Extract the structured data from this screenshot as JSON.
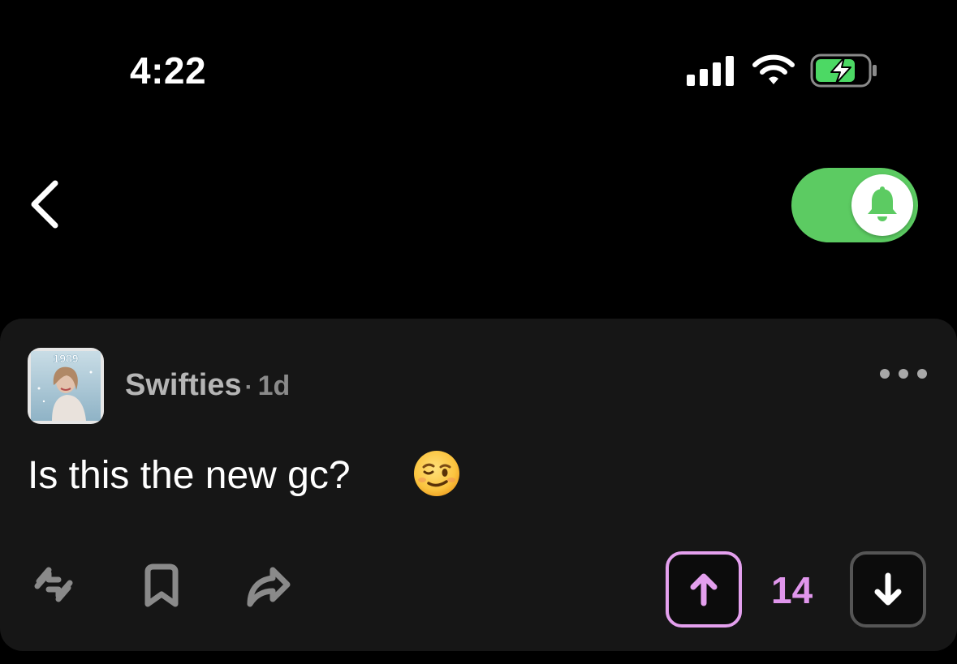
{
  "status_bar": {
    "time": "4:22",
    "icons": [
      "cellular-signal-icon",
      "wifi-icon",
      "battery-charging-icon"
    ],
    "battery_color": "#4cd964"
  },
  "nav": {
    "back_icon": "chevron-left-icon",
    "notification_toggle": {
      "state": "on",
      "icon": "bell-icon",
      "color": "#5ccb62"
    }
  },
  "post": {
    "community": "Swifties",
    "separator": "·",
    "time_ago": "1d",
    "avatar_art_text": "1989",
    "text": "Is this the new gc?",
    "emoji": "winking-face",
    "more_icon": "ellipsis-icon",
    "actions": [
      "repost-icon",
      "bookmark-icon",
      "share-icon"
    ],
    "vote_count": "14",
    "upvote_color": "#e4a0ee",
    "upvoted": true
  }
}
